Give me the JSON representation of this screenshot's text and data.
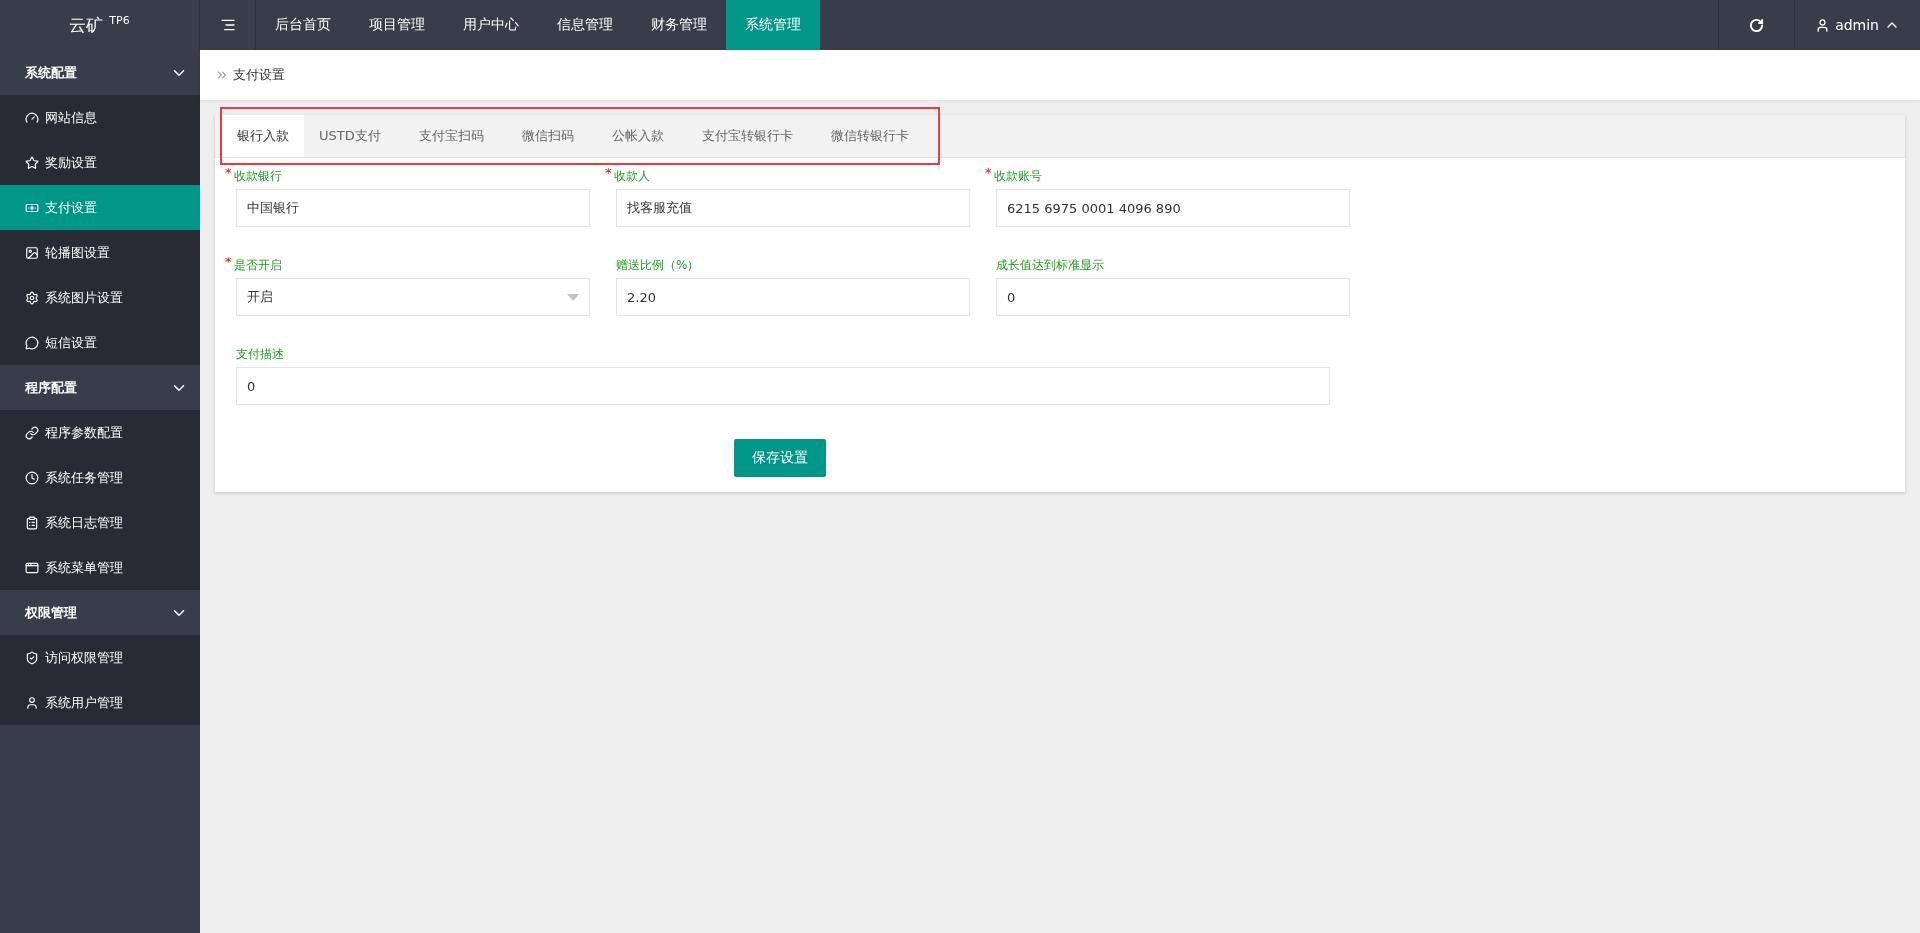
{
  "logo": {
    "name": "云矿",
    "sup": "TP6"
  },
  "top_nav": [
    {
      "label": "后台首页",
      "selected": false
    },
    {
      "label": "项目管理",
      "selected": false
    },
    {
      "label": "用户中心",
      "selected": false
    },
    {
      "label": "信息管理",
      "selected": false
    },
    {
      "label": "财务管理",
      "selected": false
    },
    {
      "label": "系统管理",
      "selected": true
    }
  ],
  "user": {
    "name": "admin"
  },
  "sidebar": [
    {
      "label": "系统配置",
      "expanded": true,
      "children": [
        {
          "label": "网站信息",
          "selected": false
        },
        {
          "label": "奖励设置",
          "selected": false
        },
        {
          "label": "支付设置",
          "selected": true
        },
        {
          "label": "轮播图设置",
          "selected": false
        },
        {
          "label": "系统图片设置",
          "selected": false
        },
        {
          "label": "短信设置",
          "selected": false
        }
      ]
    },
    {
      "label": "程序配置",
      "expanded": true,
      "children": [
        {
          "label": "程序参数配置",
          "selected": false
        },
        {
          "label": "系统任务管理",
          "selected": false
        },
        {
          "label": "系统日志管理",
          "selected": false
        },
        {
          "label": "系统菜单管理",
          "selected": false
        }
      ]
    },
    {
      "label": "权限管理",
      "expanded": true,
      "children": [
        {
          "label": "访问权限管理",
          "selected": false
        },
        {
          "label": "系统用户管理",
          "selected": false
        }
      ]
    }
  ],
  "breadcrumb": "支付设置",
  "tabs": [
    {
      "label": "银行入款",
      "selected": true
    },
    {
      "label": "USTD支付",
      "selected": false
    },
    {
      "label": "支付宝扫码",
      "selected": false
    },
    {
      "label": "微信扫码",
      "selected": false
    },
    {
      "label": "公帐入款",
      "selected": false
    },
    {
      "label": "支付宝转银行卡",
      "selected": false
    },
    {
      "label": "微信转银行卡",
      "selected": false
    }
  ],
  "form_rows": [
    [
      {
        "required_mark": "*",
        "label": "收款银行",
        "kind": "text",
        "value": "中国银行"
      },
      {
        "required_mark": "*",
        "label": "收款人",
        "kind": "text",
        "value": "找客服充值"
      },
      {
        "required_mark": "*",
        "label": "收款账号",
        "kind": "text",
        "value": "6215 6975 0001 4096 890"
      }
    ],
    [
      {
        "required_mark": "*",
        "label": "是否开启",
        "kind": "select",
        "value": "开启"
      },
      {
        "label": "赠送比例（%）",
        "kind": "text",
        "value": "2.20"
      },
      {
        "label": "成长值达到标准显示",
        "kind": "text",
        "value": "0"
      }
    ],
    [
      {
        "label": "支付描述",
        "kind": "wide",
        "value": "0"
      }
    ]
  ],
  "save_button": "保存设置"
}
